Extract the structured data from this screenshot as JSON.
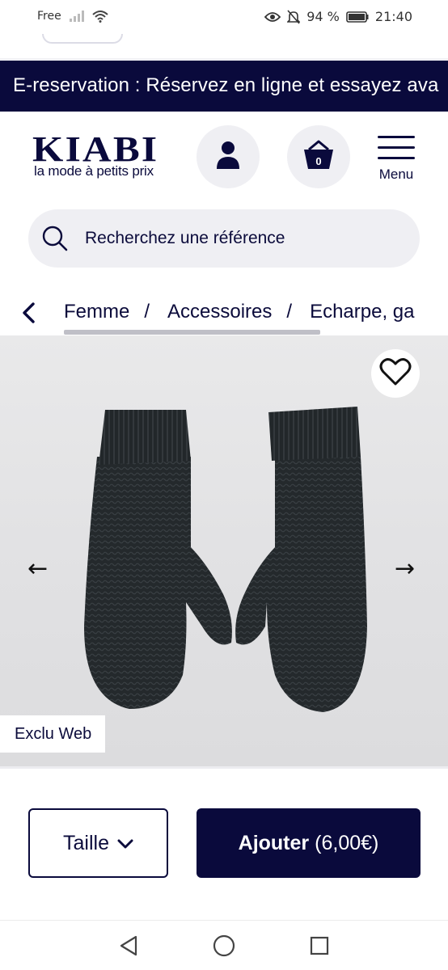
{
  "status_bar": {
    "carrier": "Free",
    "battery": "94 %",
    "time": "21:40",
    "icons": [
      "signal-icon",
      "wifi-icon",
      "eye-icon",
      "bell-off-icon",
      "battery-icon"
    ]
  },
  "banner": {
    "text": "E-reservation : Réservez en ligne et essayez ava"
  },
  "header": {
    "logo_word": "KIABI",
    "logo_tagline": "la mode à petits prix",
    "cart_count": "0",
    "menu_label": "Menu"
  },
  "search": {
    "placeholder": "Recherchez une référence"
  },
  "breadcrumb": {
    "items": [
      "Femme",
      "Accessoires",
      "Echarpe, ga"
    ],
    "separator": "/"
  },
  "product": {
    "badge": "Exclu Web",
    "prev_arrow": "←",
    "next_arrow": "→"
  },
  "actions": {
    "size_label": "Taille",
    "add_label": "Ajouter",
    "add_price": "(6,00€)"
  },
  "colors": {
    "brand_navy": "#0a0a3c",
    "light_grey": "#efeff3"
  }
}
